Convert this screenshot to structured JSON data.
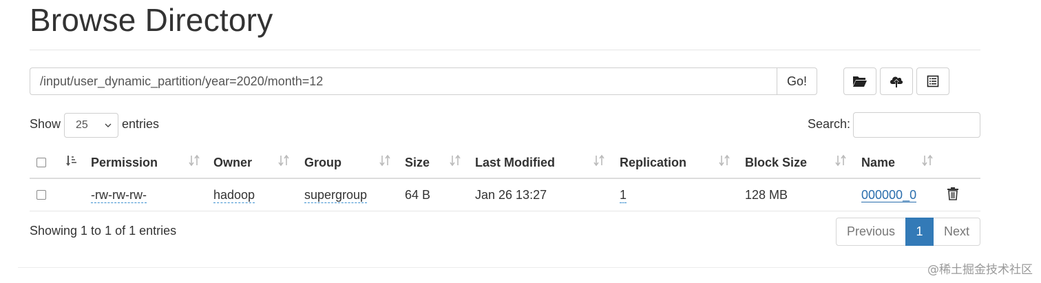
{
  "page": {
    "title": "Browse Directory"
  },
  "toolbar": {
    "path_value": "/input/user_dynamic_partition/year=2020/month=12",
    "go_label": "Go!",
    "icons": [
      "folder-open-icon",
      "upload-cloud-icon",
      "list-icon"
    ]
  },
  "controls": {
    "show_label": "Show",
    "page_length": "25",
    "entries_label": "entries",
    "search_label": "Search:",
    "search_value": ""
  },
  "table": {
    "columns": [
      "Permission",
      "Owner",
      "Group",
      "Size",
      "Last Modified",
      "Replication",
      "Block Size",
      "Name"
    ],
    "rows": [
      {
        "permission": "-rw-rw-rw-",
        "owner": "hadoop",
        "group": "supergroup",
        "size": "64 B",
        "last_modified": "Jan 26 13:27",
        "replication": "1",
        "block_size": "128 MB",
        "name": "000000_0"
      }
    ]
  },
  "footer": {
    "info": "Showing 1 to 1 of 1 entries",
    "previous_label": "Previous",
    "current_page": "1",
    "next_label": "Next"
  },
  "watermark": "@稀土掘金技术社区",
  "colors": {
    "link": "#2a6ead",
    "active_page": "#337ab7"
  }
}
